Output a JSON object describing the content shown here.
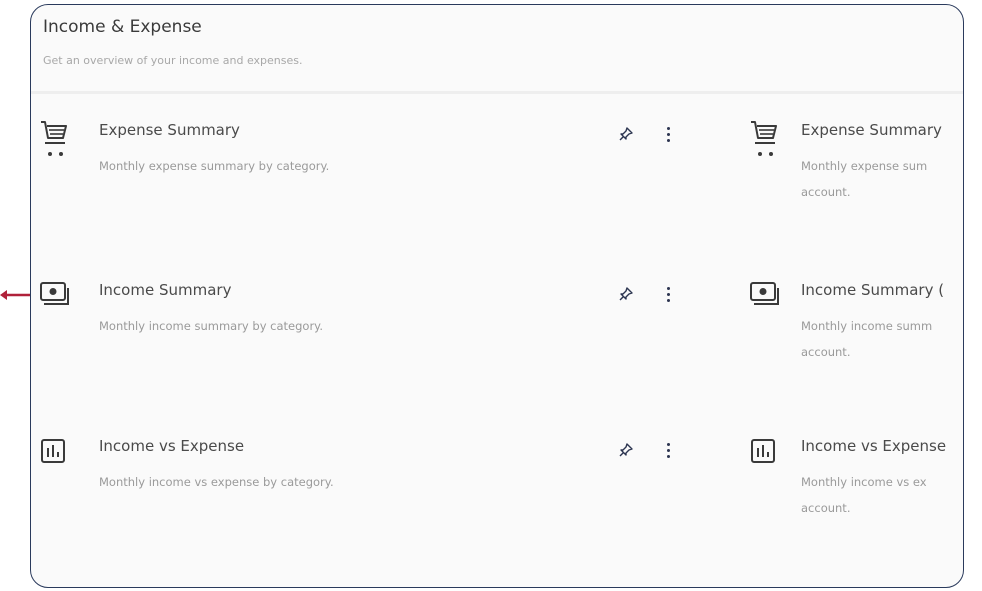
{
  "panel": {
    "title": "Income & Expense",
    "subtitle": "Get an overview of your income and expenses."
  },
  "reports": [
    {
      "icon": "shopping-cart-icon",
      "title": "Expense Summary",
      "description": "Monthly expense summary by category."
    },
    {
      "icon": "money-stack-icon",
      "title": "Income Summary",
      "description": "Monthly income summary by category."
    },
    {
      "icon": "bar-chart-icon",
      "title": "Income vs Expense",
      "description": "Monthly income vs expense by category."
    }
  ],
  "reports_right": [
    {
      "icon": "shopping-cart-icon",
      "title": "Expense Summary",
      "description": "Monthly expense sum account."
    },
    {
      "icon": "money-stack-icon",
      "title": "Income Summary (",
      "description": "Monthly income summ account."
    },
    {
      "icon": "bar-chart-icon",
      "title": "Income vs Expense",
      "description": "Monthly income vs ex account."
    }
  ],
  "colors": {
    "border": "#2a3a5c",
    "pointer": "#b0213a",
    "icon": "#3a3a3a",
    "pin": "#2c3550"
  }
}
